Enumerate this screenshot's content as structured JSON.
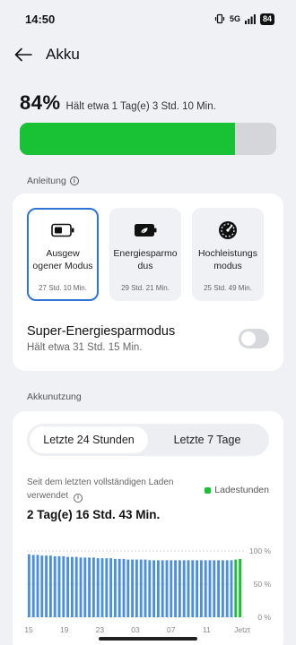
{
  "status_bar": {
    "time": "14:50",
    "network": "5G",
    "battery": "84"
  },
  "header": {
    "title": "Akku"
  },
  "summary": {
    "percent": "84%",
    "estimate": "Hält etwa 1 Tag(e) 3 Std. 10 Min.",
    "level": 0.84
  },
  "guide": {
    "label": "Anleitung"
  },
  "modes": [
    {
      "name": "Ausgew ogener Modus",
      "time": "27 Std. 10 Min.",
      "selected": true
    },
    {
      "name": "Energiesparmo dus",
      "time": "29 Std. 21 Min.",
      "selected": false
    },
    {
      "name": "Hochleistungs modus",
      "time": "25 Std. 49 Min.",
      "selected": false
    }
  ],
  "super_saver": {
    "title": "Super-Energiesparmodus",
    "subtitle": "Hält etwa 31 Std. 15 Min.",
    "enabled": false
  },
  "usage": {
    "label": "Akkunutzung",
    "tabs": [
      "Letzte 24 Stunden",
      "Letzte 7 Tage"
    ],
    "active_tab": 0,
    "caption": "Seit dem letzten vollständigen Laden verwendet",
    "legend": "Ladestunden",
    "total": "2 Tag(e) 16 Std. 43 Min."
  },
  "colors": {
    "accent": "#2f73d6",
    "charge": "#19c134",
    "bars": "#4a8fe0"
  },
  "chart_data": {
    "type": "bar",
    "x_tick_labels": [
      "15",
      "19",
      "23",
      "03",
      "07",
      "11",
      "Jetzt"
    ],
    "y_tick_labels": [
      "100 %",
      "50 %",
      "0 %"
    ],
    "ylim": [
      0,
      100
    ],
    "values": [
      95,
      94,
      94,
      93,
      93,
      93,
      92,
      92,
      92,
      91,
      91,
      91,
      90,
      90,
      90,
      90,
      89,
      89,
      89,
      89,
      88,
      88,
      88,
      87,
      87,
      87,
      87,
      87,
      86,
      86,
      86,
      86,
      86,
      86,
      86,
      86,
      86,
      86,
      86,
      86,
      86,
      86,
      86,
      86,
      86,
      86,
      86,
      86,
      87,
      88
    ],
    "charging_index_from": 48
  }
}
